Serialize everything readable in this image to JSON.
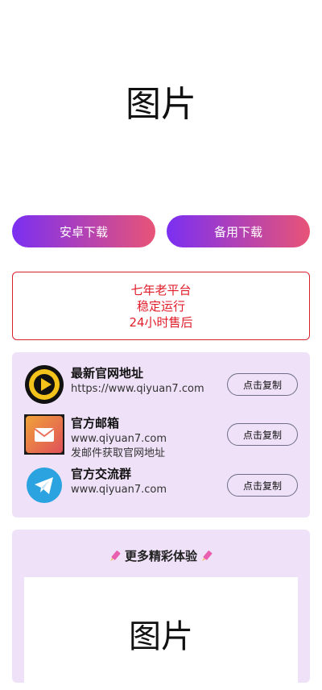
{
  "hero": {
    "image_alt": "图片"
  },
  "buttons": {
    "android": "安卓下载",
    "backup": "备用下载"
  },
  "notice": {
    "lines": [
      "七年老平台",
      "稳定运行",
      "24小时售后"
    ]
  },
  "info": [
    {
      "title": "最新官网地址",
      "lines": [
        "https://www.qiyuan7.com"
      ],
      "button": "点击复制",
      "icon": "play-logo-icon"
    },
    {
      "title": "官方邮箱",
      "lines": [
        "www.qiyuan7.com",
        "发邮件获取官网地址"
      ],
      "button": "点击复制",
      "icon": "mail-icon"
    },
    {
      "title": "官方交流群",
      "lines": [
        "www.qiyuan7.com"
      ],
      "button": "点击复制",
      "icon": "telegram-icon"
    }
  ],
  "more": {
    "title": "更多精彩体验",
    "image_alt": "图片"
  },
  "colors": {
    "gradient_start": "#7b2ff2",
    "gradient_end": "#e85477",
    "notice_red": "#e11d2a",
    "card_bg": "#efe1f7"
  }
}
